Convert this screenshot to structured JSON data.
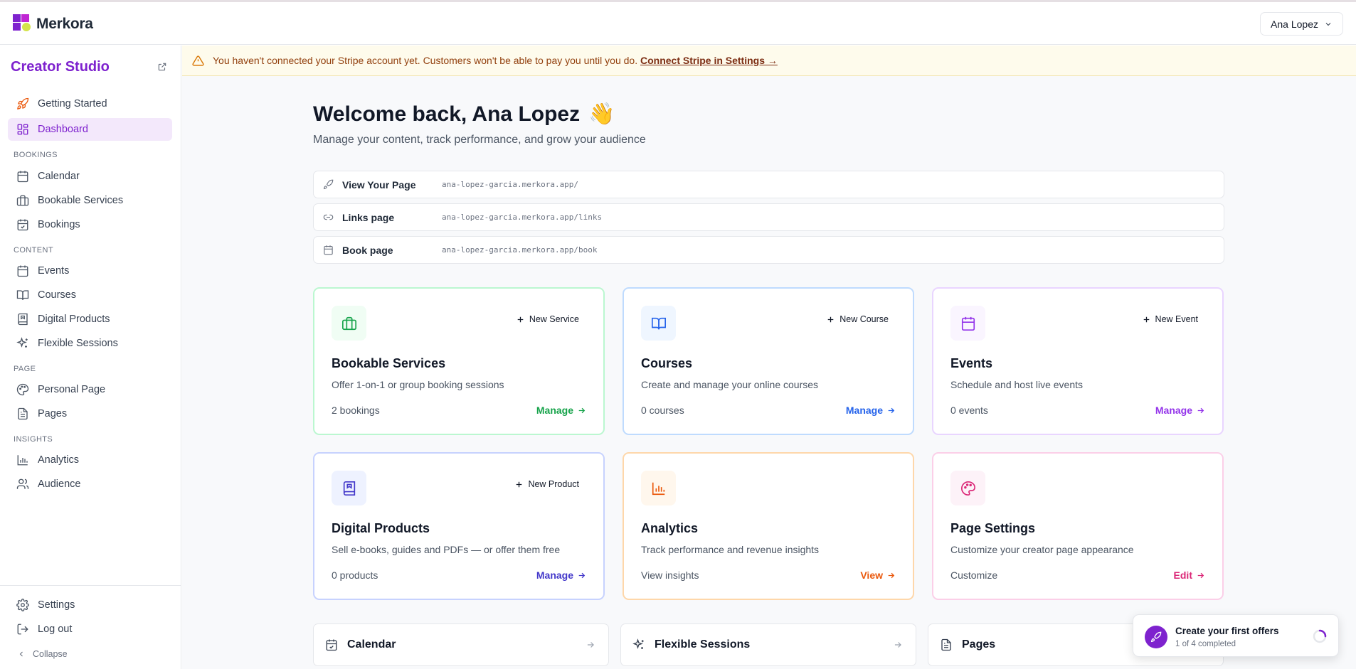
{
  "brand": {
    "name": "Merkora"
  },
  "user": {
    "name": "Ana Lopez"
  },
  "sidebar": {
    "title": "Creator Studio",
    "top_items": [
      {
        "label": "Getting Started",
        "icon": "rocket-icon"
      },
      {
        "label": "Dashboard",
        "icon": "layout-grid-icon",
        "active": true
      }
    ],
    "sections": [
      {
        "title": "BOOKINGS",
        "items": [
          {
            "label": "Calendar",
            "icon": "calendar-icon"
          },
          {
            "label": "Bookable Services",
            "icon": "briefcase-icon"
          },
          {
            "label": "Bookings",
            "icon": "calendar-check-icon"
          }
        ]
      },
      {
        "title": "CONTENT",
        "items": [
          {
            "label": "Events",
            "icon": "calendar-icon"
          },
          {
            "label": "Courses",
            "icon": "book-open-icon"
          },
          {
            "label": "Digital Products",
            "icon": "book-icon"
          },
          {
            "label": "Flexible Sessions",
            "icon": "sparkles-icon"
          }
        ]
      },
      {
        "title": "PAGE",
        "items": [
          {
            "label": "Personal Page",
            "icon": "palette-icon"
          },
          {
            "label": "Pages",
            "icon": "file-text-icon"
          }
        ]
      },
      {
        "title": "INSIGHTS",
        "items": [
          {
            "label": "Analytics",
            "icon": "bar-chart-icon"
          },
          {
            "label": "Audience",
            "icon": "users-icon"
          }
        ]
      }
    ],
    "footer": [
      {
        "label": "Settings",
        "icon": "gear-icon"
      },
      {
        "label": "Log out",
        "icon": "logout-icon"
      }
    ],
    "collapse_label": "Collapse"
  },
  "alert": {
    "message": "You haven't connected your Stripe account yet. Customers won't be able to pay you until you do.",
    "link": "Connect Stripe in Settings →"
  },
  "welcome": {
    "title": "Welcome back, Ana Lopez",
    "emoji": "👋",
    "subtitle": "Manage your content, track performance, and grow your audience"
  },
  "links": [
    {
      "label": "View Your Page",
      "url": "ana-lopez-garcia.merkora.app/",
      "icon": "rocket-icon"
    },
    {
      "label": "Links page",
      "url": "ana-lopez-garcia.merkora.app/links",
      "icon": "link-icon"
    },
    {
      "label": "Book page",
      "url": "ana-lopez-garcia.merkora.app/book",
      "icon": "calendar-icon"
    }
  ],
  "cards": [
    {
      "title": "Bookable Services",
      "desc": "Offer 1-on-1 or group booking sessions",
      "count": "2 bookings",
      "action": "Manage",
      "new_label": "New Service",
      "icon": "briefcase-icon",
      "color": "#16a34a",
      "border": "#bbf7d0",
      "icon_bg": "#f0fdf4"
    },
    {
      "title": "Courses",
      "desc": "Create and manage your online courses",
      "count": "0 courses",
      "action": "Manage",
      "new_label": "New Course",
      "icon": "book-open-icon",
      "color": "#2563eb",
      "border": "#bfdbfe",
      "icon_bg": "#eff6ff"
    },
    {
      "title": "Events",
      "desc": "Schedule and host live events",
      "count": "0 events",
      "action": "Manage",
      "new_label": "New Event",
      "icon": "calendar-icon",
      "color": "#9333ea",
      "border": "#e9d5ff",
      "icon_bg": "#faf5ff"
    },
    {
      "title": "Digital Products",
      "desc": "Sell e-books, guides and PDFs — or offer them free",
      "count": "0 products",
      "action": "Manage",
      "new_label": "New Product",
      "icon": "book-icon",
      "color": "#4338ca",
      "border": "#c7d2fe",
      "icon_bg": "#eef2ff"
    },
    {
      "title": "Analytics",
      "desc": "Track performance and revenue insights",
      "count": "View insights",
      "action": "View",
      "new_label": "",
      "icon": "bar-chart-icon",
      "color": "#ea580c",
      "border": "#fed7aa",
      "icon_bg": "#fff7ed"
    },
    {
      "title": "Page Settings",
      "desc": "Customize your creator page appearance",
      "count": "Customize",
      "action": "Edit",
      "new_label": "",
      "icon": "palette-icon",
      "color": "#db2777",
      "border": "#fbcfe8",
      "icon_bg": "#fdf2f8"
    }
  ],
  "quick_links": [
    {
      "label": "Calendar",
      "icon": "calendar-check-icon"
    },
    {
      "label": "Flexible Sessions",
      "icon": "sparkles-icon"
    },
    {
      "label": "Pages",
      "icon": "file-text-icon"
    }
  ],
  "toast": {
    "title": "Create your first offers",
    "subtitle": "1 of 4 completed",
    "progress": 0.25
  }
}
